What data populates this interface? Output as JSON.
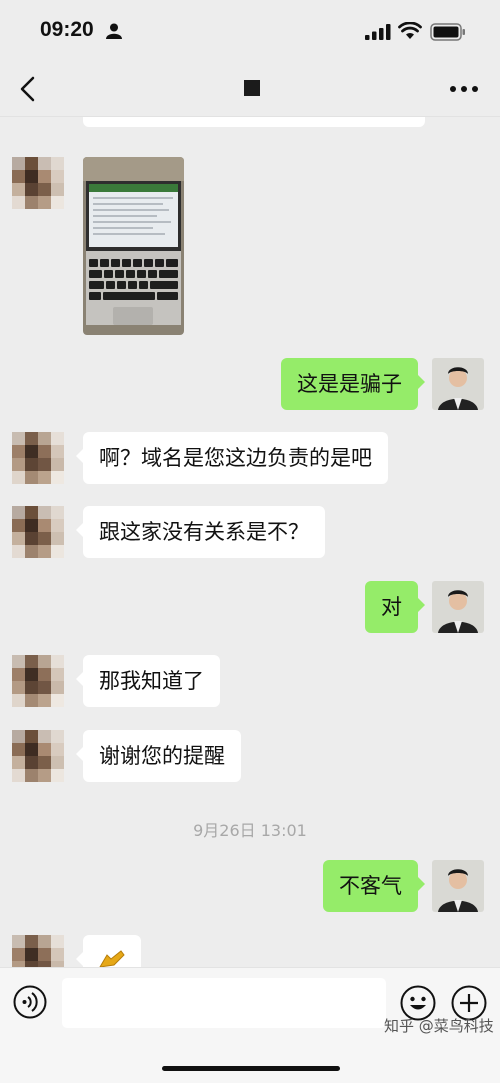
{
  "status_bar": {
    "time": "09:20"
  },
  "nav": {
    "back_icon": "chevron-left-icon",
    "more_icon": "more-dots-icon"
  },
  "messages": [
    {
      "from": "them",
      "type": "image"
    },
    {
      "from": "me",
      "text": "这是是骗子"
    },
    {
      "from": "them",
      "text": "啊？域名是您这边负责的是吧"
    },
    {
      "from": "them",
      "text": "跟这家没有关系是不？"
    },
    {
      "from": "me",
      "text": "对"
    },
    {
      "from": "them",
      "text": "那我知道了"
    },
    {
      "from": "them",
      "text": "谢谢您的提醒"
    },
    {
      "type": "timestamp",
      "text": "9月26日 13:01"
    },
    {
      "from": "me",
      "text": "不客气"
    },
    {
      "from": "them",
      "type": "sticker"
    }
  ],
  "input_bar": {
    "placeholder": "",
    "voice_icon": "voice-icon",
    "emoji_icon": "emoji-icon",
    "add_icon": "plus-circle-icon"
  },
  "watermark": "知乎 @菜鸟科技",
  "colors": {
    "background": "#ededed",
    "my_bubble": "#95ec69",
    "their_bubble": "#ffffff",
    "timestamp_text": "#a8a8a8"
  }
}
